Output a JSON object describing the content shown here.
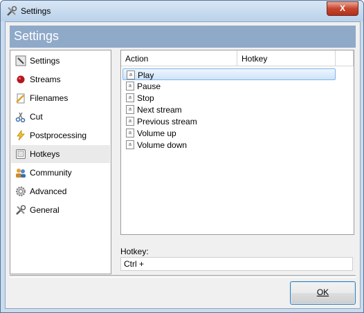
{
  "window": {
    "title": "Settings",
    "close_label": "X"
  },
  "header": {
    "title": "Settings"
  },
  "sidebar": {
    "items": [
      {
        "label": "Settings",
        "icon": "settings-icon"
      },
      {
        "label": "Streams",
        "icon": "record-icon"
      },
      {
        "label": "Filenames",
        "icon": "filenames-icon"
      },
      {
        "label": "Cut",
        "icon": "scissors-icon"
      },
      {
        "label": "Postprocessing",
        "icon": "lightning-icon"
      },
      {
        "label": "Hotkeys",
        "icon": "keyboard-key-icon",
        "selected": true
      },
      {
        "label": "Community",
        "icon": "community-icon"
      },
      {
        "label": "Advanced",
        "icon": "gear-icon"
      },
      {
        "label": "General",
        "icon": "tools-icon"
      }
    ]
  },
  "list": {
    "columns": [
      "Action",
      "Hotkey"
    ],
    "rows": [
      {
        "action": "Play",
        "hotkey": "",
        "selected": true
      },
      {
        "action": "Pause",
        "hotkey": ""
      },
      {
        "action": "Stop",
        "hotkey": ""
      },
      {
        "action": "Next stream",
        "hotkey": ""
      },
      {
        "action": "Previous stream",
        "hotkey": ""
      },
      {
        "action": "Volume up",
        "hotkey": ""
      },
      {
        "action": "Volume down",
        "hotkey": ""
      }
    ]
  },
  "hotkey": {
    "label": "Hotkey:",
    "value": "Ctrl +"
  },
  "buttons": {
    "ok_label": "OK"
  },
  "colors": {
    "header_bg": "#8fa9c9",
    "selection_border": "#7eb4ea",
    "close_red": "#c8452c"
  }
}
